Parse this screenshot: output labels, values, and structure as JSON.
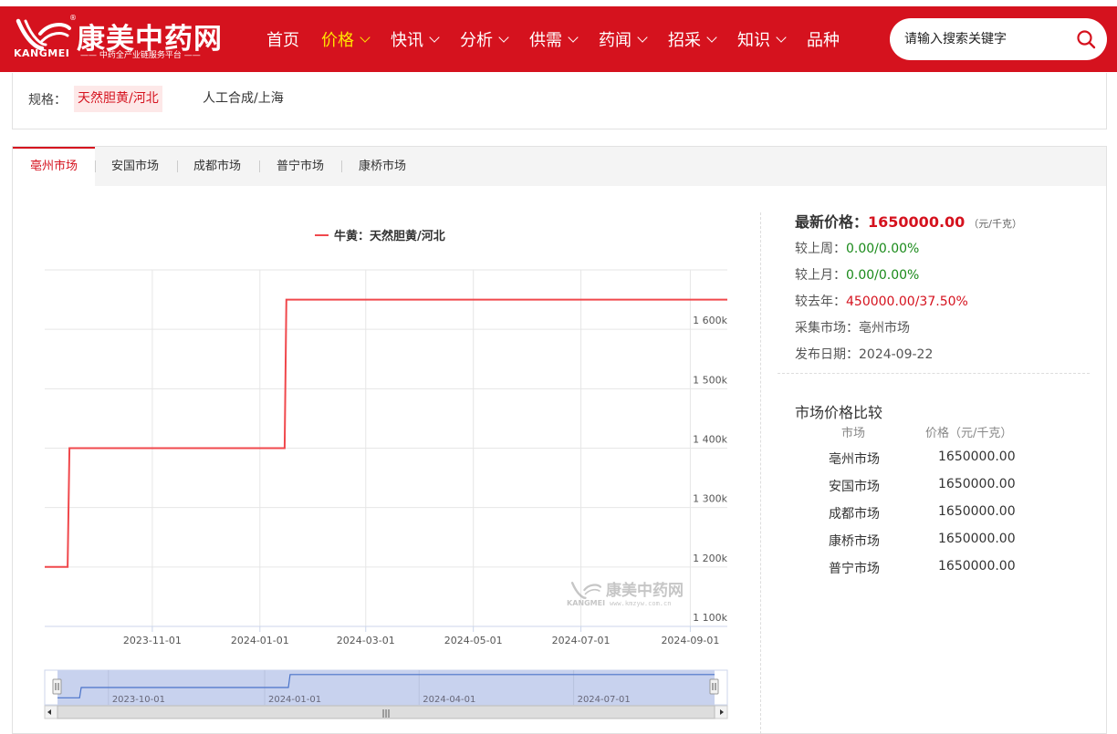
{
  "header": {
    "logo_cn": "康美中药网",
    "logo_en": "KANGMEI",
    "logo_reg": "®",
    "logo_slogan": "—— 中药全产业链服务平台 ——",
    "brand_color": "#d5121e",
    "nav": [
      {
        "label": "首页",
        "dropdown": false,
        "active": false
      },
      {
        "label": "价格",
        "dropdown": true,
        "active": true
      },
      {
        "label": "快讯",
        "dropdown": true,
        "active": false
      },
      {
        "label": "分析",
        "dropdown": true,
        "active": false
      },
      {
        "label": "供需",
        "dropdown": true,
        "active": false
      },
      {
        "label": "药闻",
        "dropdown": true,
        "active": false
      },
      {
        "label": "招采",
        "dropdown": true,
        "active": false
      },
      {
        "label": "知识",
        "dropdown": true,
        "active": false
      },
      {
        "label": "品种",
        "dropdown": false,
        "active": false
      }
    ],
    "search": {
      "placeholder": "请输入搜索关键字",
      "icon": "search-icon"
    }
  },
  "spec": {
    "label": "规格：",
    "options": [
      {
        "label": "天然胆黄/河北",
        "active": true
      },
      {
        "label": "人工合成/上海",
        "active": false
      }
    ]
  },
  "market_tabs": [
    {
      "label": "亳州市场",
      "active": true
    },
    {
      "label": "安国市场",
      "active": false
    },
    {
      "label": "成都市场",
      "active": false
    },
    {
      "label": "普宁市场",
      "active": false
    },
    {
      "label": "康桥市场",
      "active": false
    }
  ],
  "chart_data": {
    "type": "line",
    "step": true,
    "legend": "牛黄：天然胆黄/河北",
    "legend_position": "top-center",
    "series_color": "#f0484c",
    "x_type": "date",
    "x_range": [
      "2023-09-01",
      "2024-09-22"
    ],
    "x_ticks": [
      "2023-11-01",
      "2024-01-01",
      "2024-03-01",
      "2024-05-01",
      "2024-07-01",
      "2024-09-01"
    ],
    "y_axis_position": "right",
    "ylim": [
      1100000,
      1700000
    ],
    "y_ticks": [
      1100000,
      1200000,
      1300000,
      1400000,
      1500000,
      1600000
    ],
    "y_tick_labels": [
      "1 100k",
      "1 200k",
      "1 300k",
      "1 400k",
      "1 500k",
      "1 600k"
    ],
    "grid": true,
    "points": [
      {
        "x": "2023-09-01",
        "y": 1200000
      },
      {
        "x": "2023-09-14",
        "y": 1200000
      },
      {
        "x": "2023-09-15",
        "y": 1400000
      },
      {
        "x": "2024-01-15",
        "y": 1400000
      },
      {
        "x": "2024-01-16",
        "y": 1650000
      },
      {
        "x": "2024-09-22",
        "y": 1650000
      }
    ],
    "watermark": {
      "cn": "康美中药网",
      "en": "KANGMEI",
      "url": "www.kmzyw.com.cn"
    },
    "navigator": {
      "range": [
        "2023-09-01",
        "2024-09-22"
      ],
      "tick_labels": [
        "2023-10-01",
        "2024-01-01",
        "2024-04-01",
        "2024-07-01"
      ],
      "tick_dates": [
        "2023-10-01",
        "2024-01-01",
        "2024-04-01",
        "2024-07-01"
      ],
      "handle_glyph": "|||"
    }
  },
  "latest": {
    "label": "最新价格：",
    "value": "1650000.00",
    "unit": "（元/千克）",
    "rows": [
      {
        "label": "较上周：",
        "value": "0.00/0.00%",
        "tone": "green"
      },
      {
        "label": "较上月：",
        "value": "0.00/0.00%",
        "tone": "green"
      },
      {
        "label": "较去年：",
        "value": "450000.00/37.50%",
        "tone": "red"
      },
      {
        "label": "采集市场：",
        "value": "亳州市场",
        "tone": "plain"
      },
      {
        "label": "发布日期：",
        "value": "2024-09-22",
        "tone": "plain"
      }
    ]
  },
  "comparison": {
    "title": "市场价格比较",
    "headers": [
      "市场",
      "价格（元/千克）"
    ],
    "rows": [
      {
        "market": "亳州市场",
        "price": "1650000.00"
      },
      {
        "market": "安国市场",
        "price": "1650000.00"
      },
      {
        "market": "成都市场",
        "price": "1650000.00"
      },
      {
        "market": "康桥市场",
        "price": "1650000.00"
      },
      {
        "market": "普宁市场",
        "price": "1650000.00"
      }
    ]
  }
}
